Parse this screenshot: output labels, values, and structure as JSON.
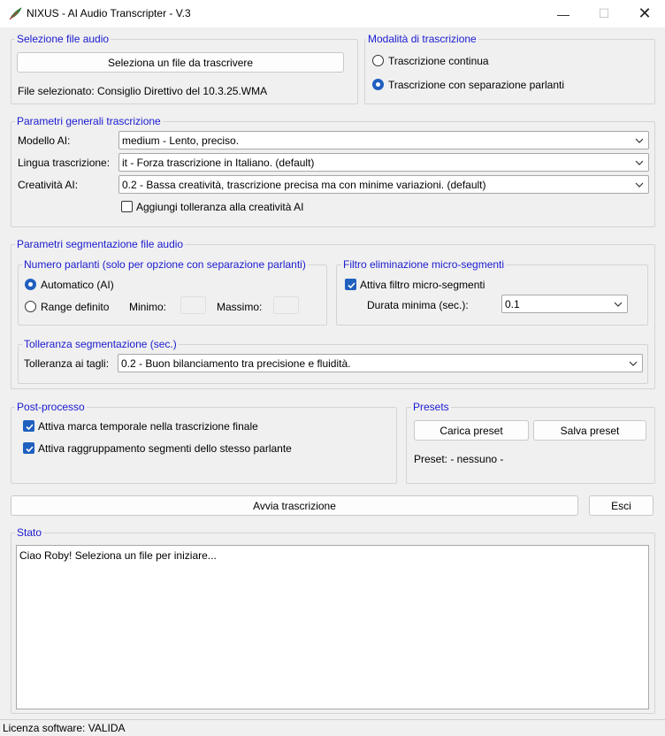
{
  "window": {
    "title": "NIXUS - AI Audio Transcripter - V.3",
    "minimize_symbol": "—",
    "maximize_symbol": "☐",
    "close_symbol": "✕"
  },
  "file_section": {
    "title": "Selezione file audio",
    "select_button": "Seleziona un file da trascrivere",
    "selected_file": "File selezionato: Consiglio Direttivo del 10.3.25.WMA"
  },
  "mode_section": {
    "title": "Modalità di trascrizione",
    "options": [
      {
        "label": "Trascrizione continua",
        "checked": false
      },
      {
        "label": "Trascrizione con separazione parlanti",
        "checked": true
      }
    ]
  },
  "general_params": {
    "title": "Parametri generali trascrizione",
    "model_label": "Modello AI:",
    "model_value": "medium - Lento, preciso.",
    "language_label": "Lingua trascrizione:",
    "language_value": "it - Forza trascrizione in Italiano. (default)",
    "creativity_label": "Creatività AI:",
    "creativity_value": "0.2 - Bassa creatività, trascrizione precisa ma con minime variazioni. (default)",
    "tolerance_checkbox": "Aggiungi tolleranza alla creatività AI",
    "tolerance_checked": false
  },
  "segmentation": {
    "title": "Parametri segmentazione file audio",
    "speakers": {
      "title": "Numero parlanti (solo per opzione con separazione parlanti)",
      "auto_label": "Automatico (AI)",
      "auto_checked": true,
      "range_label": "Range definito",
      "range_checked": false,
      "min_label": "Minimo:",
      "max_label": "Massimo:"
    },
    "filter": {
      "title": "Filtro eliminazione micro-segmenti",
      "enable_label": "Attiva filtro micro-segmenti",
      "enable_checked": true,
      "duration_label": "Durata minima (sec.):",
      "duration_value": "0.1"
    },
    "tolerance": {
      "title": "Tolleranza segmentazione (sec.)",
      "cut_label": "Tolleranza ai tagli:",
      "cut_value": "0.2 - Buon bilanciamento tra precisione e fluidità."
    }
  },
  "postprocess": {
    "title": "Post-processo",
    "timestamp_label": "Attiva marca temporale nella trascrizione finale",
    "timestamp_checked": true,
    "grouping_label": "Attiva raggruppamento segmenti dello stesso parlante",
    "grouping_checked": true
  },
  "presets": {
    "title": "Presets",
    "load_button": "Carica preset",
    "save_button": "Salva preset",
    "current": "Preset: - nessuno -"
  },
  "actions": {
    "start_button": "Avvia trascrizione",
    "exit_button": "Esci"
  },
  "status": {
    "title": "Stato",
    "log_text": "Ciao Roby! Seleziona un file per iniziare..."
  },
  "statusbar": {
    "license_text": "Licenza software: VALIDA"
  },
  "colors": {
    "group_title": "#1a1ad0",
    "accent": "#1f5fbf"
  }
}
